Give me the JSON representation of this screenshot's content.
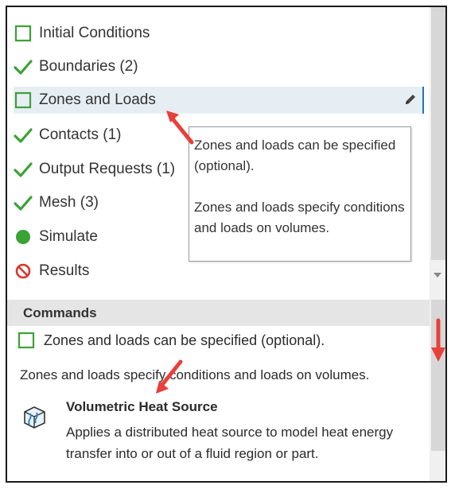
{
  "tree": {
    "items": [
      {
        "label": "Initial Conditions",
        "status": "pending",
        "icon": "empty-square-icon"
      },
      {
        "label": "Boundaries (2)",
        "status": "done",
        "icon": "checkmark-icon"
      },
      {
        "label": "Zones and Loads",
        "status": "pending",
        "icon": "empty-square-icon",
        "selected": true
      },
      {
        "label": "Contacts (1)",
        "status": "done",
        "icon": "checkmark-icon"
      },
      {
        "label": "Output Requests (1)",
        "status": "done",
        "icon": "checkmark-icon"
      },
      {
        "label": "Mesh (3)",
        "status": "done",
        "icon": "checkmark-icon"
      },
      {
        "label": "Simulate",
        "status": "ready",
        "icon": "green-circle-icon"
      },
      {
        "label": "Results",
        "status": "blocked",
        "icon": "no-entry-icon"
      }
    ]
  },
  "tooltip": {
    "line1": "Zones and loads can be specified (optional).",
    "line2": "Zones and loads specify conditions and loads on volumes."
  },
  "commands": {
    "header": "Commands",
    "status_text": "Zones and loads can be specified (optional).",
    "description": "Zones and loads specify conditions and loads on volumes.",
    "item": {
      "title": "Volumetric Heat Source",
      "text": "Applies a distributed heat source to model heat energy transfer into or out of a fluid region or part.",
      "icon": "volumetric-heat-source-icon"
    }
  },
  "colors": {
    "check": "#3aa335",
    "square": "#3aa335",
    "annotation_arrow": "#e8403a",
    "selection_bg": "#e7eef3",
    "selection_border": "#1f73b7"
  }
}
